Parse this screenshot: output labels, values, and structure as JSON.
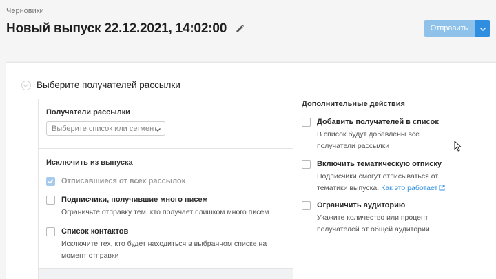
{
  "header": {
    "breadcrumb": "Черновики",
    "title": "Новый выпуск 22.12.2021, 14:02:00",
    "send_label": "Отправить"
  },
  "step": {
    "title": "Выберите получателей рассылки"
  },
  "recipients": {
    "label": "Получатели рассылки",
    "select_placeholder": "Выберите список или сегмент"
  },
  "exclude": {
    "label": "Исключить из выпуска",
    "items": [
      {
        "label": "Отписавшиеся от всех рассылок",
        "checked": true,
        "disabled": true,
        "desc": ""
      },
      {
        "label": "Подписчики, получившие много писем",
        "checked": false,
        "disabled": false,
        "desc": "Ограничьте отправку тем, кто получает слишком много писем"
      },
      {
        "label": "Список контактов",
        "checked": false,
        "disabled": false,
        "desc_line1": "Исключите тех, кто будет находиться в выбранном списке на",
        "desc_line2": "момент отправки"
      }
    ]
  },
  "extra": {
    "title": "Дополнительные действия",
    "items": [
      {
        "label": "Добавить получателей в список",
        "desc_line1": "В список будут добавлены все",
        "desc_line2": "получатели рассылки"
      },
      {
        "label": "Включить тематическую отписку",
        "desc_line1": "Подписчики смогут отписываться от",
        "desc_line2": "тематики выпуска.",
        "link": "Как это работает"
      },
      {
        "label": "Ограничить аудиторию",
        "desc_line1": "Укажите количество или процент",
        "desc_line2": "получателей от общей аудитории"
      }
    ]
  },
  "colors": {
    "accent": "#2f8ee0",
    "send_disabled": "#8ec2ea",
    "background": "#f5f5f5"
  },
  "icons": {
    "edit": "pencil-icon",
    "dropdown": "chevron-down-icon",
    "step": "check-circle-icon",
    "external": "external-link-icon",
    "cursor": "mouse-pointer-icon"
  }
}
